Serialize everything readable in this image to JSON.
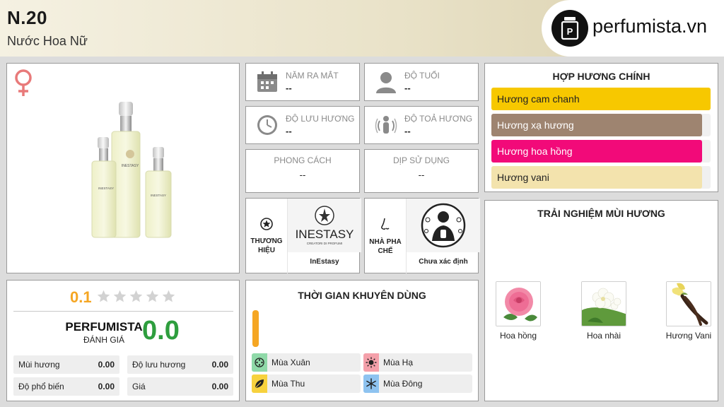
{
  "header": {
    "title": "N.20",
    "subtitle": "Nước Hoa Nữ",
    "logo_text": "perfumista.vn"
  },
  "info": {
    "release": {
      "label": "NĂM RA MẮT",
      "value": "--"
    },
    "age": {
      "label": "ĐỘ TUỔI",
      "value": "--"
    },
    "longevity": {
      "label": "ĐỘ LƯU HƯƠNG",
      "value": "--"
    },
    "sillage": {
      "label": "ĐỘ TOẢ HƯƠNG",
      "value": "--"
    },
    "style": {
      "label": "PHONG CÁCH",
      "value": "--"
    },
    "occasion": {
      "label": "DỊP SỬ DỤNG",
      "value": "--"
    }
  },
  "brand": {
    "label_line1": "THƯƠNG",
    "label_line2": "HIỆU",
    "logo_text": "INESTASY",
    "logo_sub": "CREATORI DI PROFUMI",
    "name": "InEstasy"
  },
  "perfumer": {
    "label_line1": "NHÀ PHA",
    "label_line2": "CHẾ",
    "name": "Chưa xác định"
  },
  "accords": {
    "title": "HỢP HƯƠNG CHÍNH",
    "items": [
      {
        "label": "Hương cam chanh",
        "color": "#f7c800",
        "fill": 1.0,
        "text_color": "#222222"
      },
      {
        "label": "Hương xạ hương",
        "color": "#9e8470",
        "fill": 0.96,
        "text_color": "#ffffff"
      },
      {
        "label": "Hương hoa hồng",
        "color": "#f20a79",
        "fill": 0.96,
        "text_color": "#ffffff"
      },
      {
        "label": "Hương vani",
        "color": "#f3e3ad",
        "fill": 0.96,
        "text_color": "#222222"
      }
    ]
  },
  "experience": {
    "title": "TRẢI NGHIỆM MÙI HƯƠNG",
    "notes": [
      {
        "label": "Hoa hồng",
        "icon": "rose-icon"
      },
      {
        "label": "Hoa nhài",
        "icon": "jasmine-icon"
      },
      {
        "label": "Hương Vani",
        "icon": "vanilla-icon"
      }
    ]
  },
  "rating": {
    "user_score": "0.1",
    "stars": 5,
    "brand_line1": "PERFUMISTA",
    "brand_line2": "ĐÁNH GIÁ",
    "perfumista_score": "0.0",
    "stats": [
      {
        "label": "Mùi hương",
        "value": "0.00"
      },
      {
        "label": "Độ lưu hương",
        "value": "0.00"
      },
      {
        "label": "Độ phổ biến",
        "value": "0.00"
      },
      {
        "label": "Giá",
        "value": "0.00"
      }
    ]
  },
  "time": {
    "title": "THỜI GIAN KHUYÊN DÙNG",
    "seasons": [
      {
        "label": "Mùa Xuân",
        "color": "#8fd9a8"
      },
      {
        "label": "Mùa Hạ",
        "color": "#f4a0aa"
      },
      {
        "label": "Mùa Thu",
        "color": "#f7d23e"
      },
      {
        "label": "Mùa Đông",
        "color": "#8ec3f0"
      }
    ]
  },
  "colors": {
    "accent_orange": "#f5a623",
    "score_green": "#2e9e3e",
    "venus_pink": "#e87a7a"
  }
}
